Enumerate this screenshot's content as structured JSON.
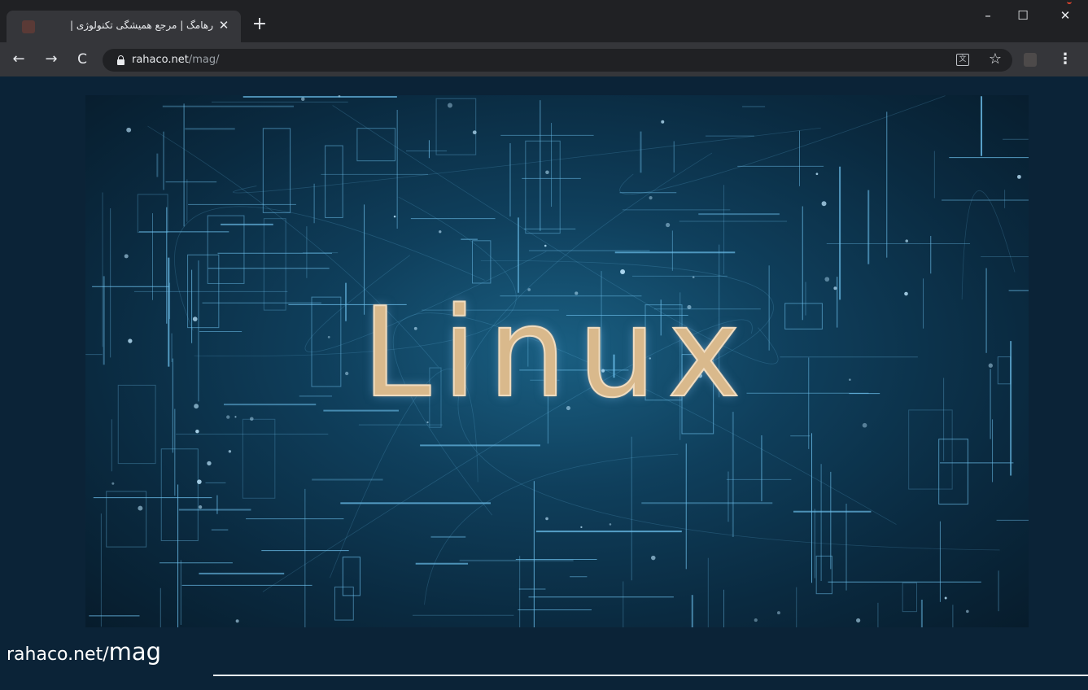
{
  "tab": {
    "title": "رهامگ | مرجع همیشگی تکنولوژی |",
    "close_glyph": "✕"
  },
  "new_tab_glyph": "+",
  "window_controls": {
    "minimize_glyph": "–",
    "maximize_glyph": "☐",
    "close_glyph": "✕"
  },
  "toolbar": {
    "back_glyph": "←",
    "forward_glyph": "→",
    "reload_glyph": "C",
    "url_host": "rahaco.net",
    "url_path": "/mag/",
    "translate_glyph": "文",
    "bookmark_glyph": "☆",
    "menu_glyph": "⋮"
  },
  "page": {
    "hero_text": "Linux",
    "footer_host": "rahaco.net/",
    "footer_path": "mag"
  },
  "colors": {
    "page_background": "#0b2337",
    "hero_text": "#d9b98c",
    "circuit_lines": "#6fc3f0"
  }
}
